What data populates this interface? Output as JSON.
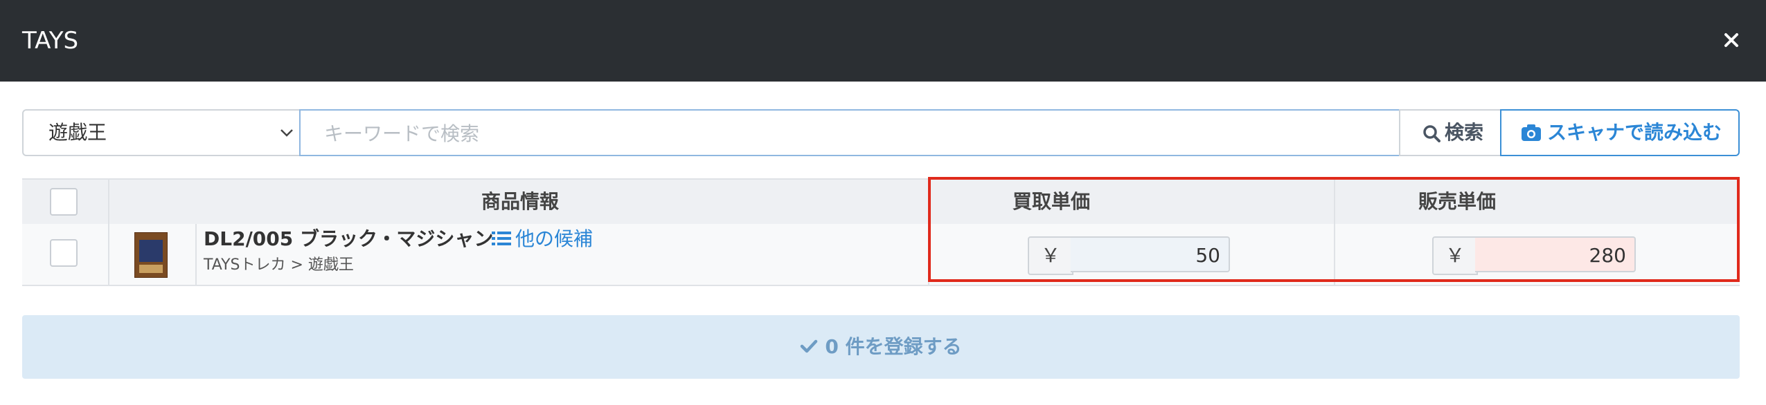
{
  "header": {
    "title": "TAYS",
    "close_label": "×"
  },
  "search": {
    "category_selected": "遊戯王",
    "placeholder": "キーワードで検索",
    "search_button": "検索",
    "scan_button": "スキャナで読み込む"
  },
  "table": {
    "headers": {
      "product": "商品情報",
      "buy_price": "買取単価",
      "sell_price": "販売単価"
    },
    "rows": [
      {
        "name": "DL2/005 ブラック・マジシャン",
        "candidates_label": "他の候補",
        "breadcrumb": "TAYSトレカ > 遊戯王",
        "currency": "￥",
        "buy_price": "50",
        "sell_price": "280"
      }
    ]
  },
  "submit": {
    "label": "0 件を登録する"
  },
  "colors": {
    "header_bg": "#2b2f33",
    "accent": "#2b86d6",
    "highlight": "#e02a1c",
    "submit_bg": "#dbeaf6",
    "sell_input_bg": "#fde8e6",
    "buy_input_bg": "#eef3f8"
  }
}
